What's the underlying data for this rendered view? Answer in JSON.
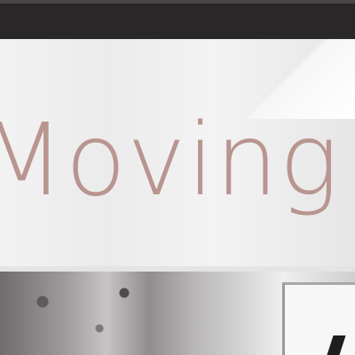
{
  "hero": {
    "headline": "Moving",
    "headline_color": "#b9958f"
  },
  "colors": {
    "top_bar": "#2a2729",
    "hero_background": "#eeeeee"
  }
}
